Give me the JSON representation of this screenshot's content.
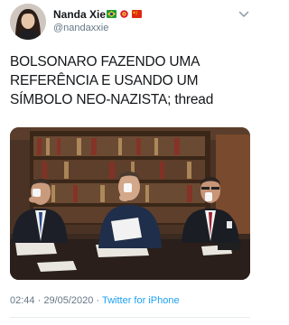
{
  "author": {
    "name": "Nanda Xie",
    "handle": "@nandaxxie"
  },
  "tweet": {
    "text_lines": [
      "BOLSONARO FAZENDO UMA",
      "REFERÊNCIA E USANDO UM",
      "SÍMBOLO NEO-NAZISTA; thread"
    ],
    "time": "02:44",
    "date": "29/05/2020",
    "source": "Twitter for iPhone"
  },
  "colors": {
    "link": "#1da1f2",
    "secondary_text": "#657786"
  },
  "icons": [
    "brazil-flag-icon",
    "china-emblem-icon",
    "china-flag-icon",
    "chevron-down-icon"
  ]
}
